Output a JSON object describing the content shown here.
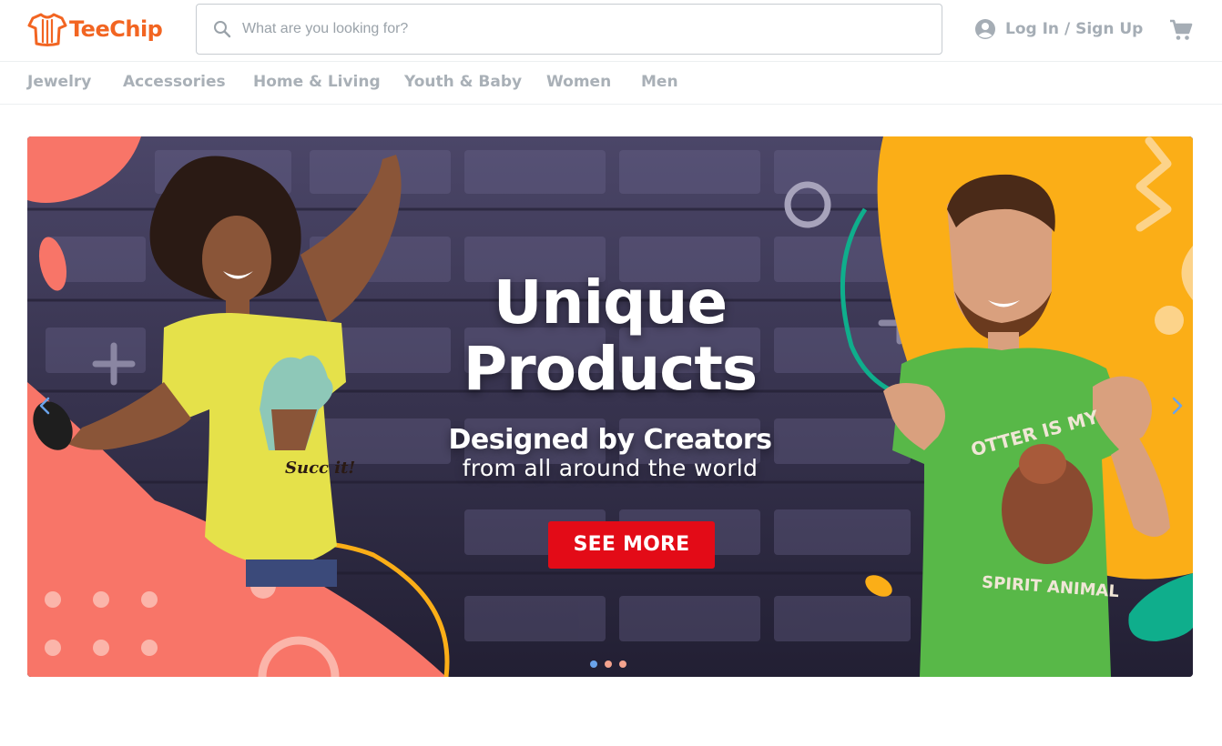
{
  "brand": {
    "name": "TeeChip",
    "color": "#f26522"
  },
  "search": {
    "placeholder": "What are you looking for?",
    "icon": "search-icon"
  },
  "account": {
    "label": "Log In / Sign Up",
    "icon": "user-circle-icon"
  },
  "cart": {
    "icon": "shopping-cart-icon"
  },
  "nav": {
    "items": [
      {
        "label": "Jewelry"
      },
      {
        "label": "Accessories"
      },
      {
        "label": "Home & Living"
      },
      {
        "label": "Youth & Baby"
      },
      {
        "label": "Women"
      },
      {
        "label": "Men"
      }
    ]
  },
  "banner": {
    "title_line1": "Unique",
    "title_line2": "Products",
    "subtitle_line1": "Designed by Creators",
    "subtitle_line2": "from all around the world",
    "cta_label": "SEE MORE",
    "left_shirt_text": "Succ it!",
    "right_shirt_text_top": "OTTER IS MY",
    "right_shirt_text_bottom": "SPIRIT ANIMAL",
    "slides": 3,
    "active_slide": 1,
    "colors": {
      "background": "#3a3552",
      "coral": "#f87568",
      "yellow": "#fbae17",
      "teal": "#0fae8c",
      "cta": "#e30b17",
      "dot_active": "#6aa3ea",
      "dot_inactive": "#f4a38e"
    }
  }
}
